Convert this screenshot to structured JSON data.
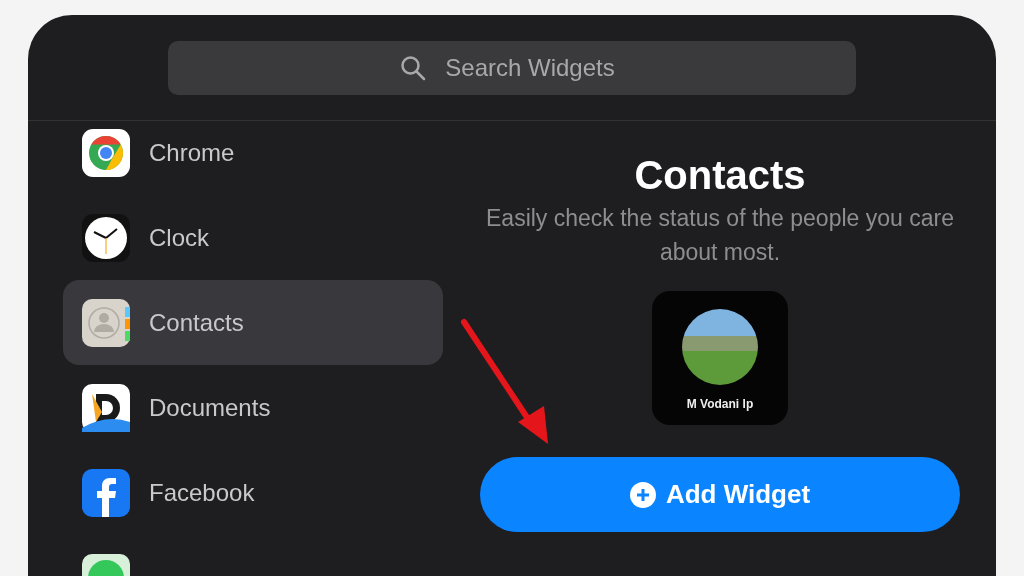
{
  "search": {
    "placeholder": "Search Widgets"
  },
  "apps": [
    {
      "kind": "chrome",
      "label": "Chrome",
      "selected": false
    },
    {
      "kind": "clock",
      "label": "Clock",
      "selected": false
    },
    {
      "kind": "contacts",
      "label": "Contacts",
      "selected": true
    },
    {
      "kind": "documents",
      "label": "Documents",
      "selected": false
    },
    {
      "kind": "facebook",
      "label": "Facebook",
      "selected": false
    },
    {
      "kind": "findmy",
      "selected": false
    }
  ],
  "detail": {
    "title": "Contacts",
    "description": "Easily check the status of the people you care about most.",
    "widget": {
      "name": "M Vodani Ip"
    },
    "button": "Add Widget"
  }
}
